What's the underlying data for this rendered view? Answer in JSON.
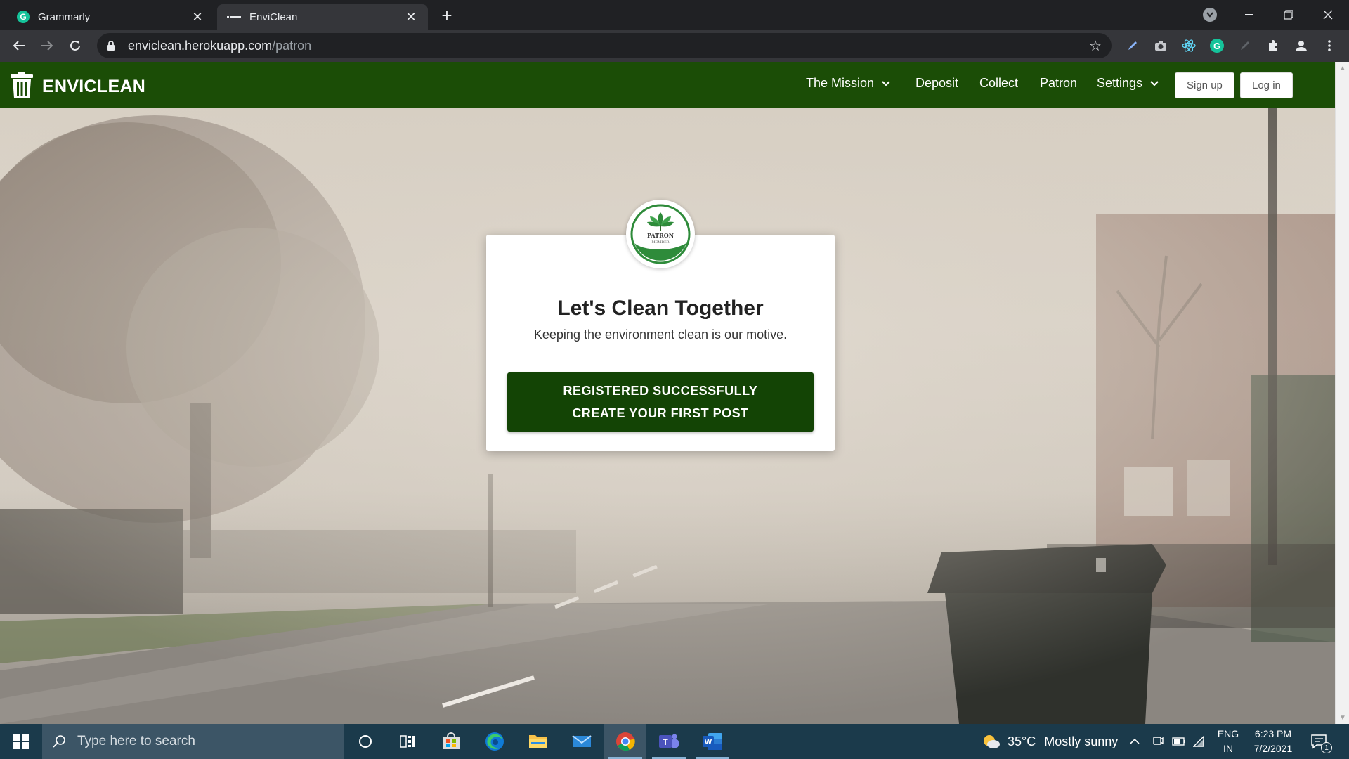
{
  "browser": {
    "tabs": [
      {
        "title": "Grammarly",
        "favicon": "grammarly-icon",
        "active": false
      },
      {
        "title": "EnviClean",
        "favicon": "dash-icon",
        "active": true
      }
    ],
    "url_host": "enviclean.herokuapp.com",
    "url_path": "/patron"
  },
  "site": {
    "brand": "ENVICLEAN",
    "brand_icon": "trash-can-icon",
    "colors": {
      "navbar": "#1b4d06",
      "button": "#134405"
    },
    "nav": {
      "mission": "The Mission",
      "deposit": "Deposit",
      "collect": "Collect",
      "patron": "Patron",
      "settings": "Settings",
      "signup": "Sign up",
      "login": "Log in"
    }
  },
  "card": {
    "badge_top": "PATRON",
    "badge_bottom": "MEMBER",
    "title": "Let's Clean Together",
    "subtitle": "Keeping the environment clean is our motive.",
    "cta_line1": "REGISTERED SUCCESSFULLY",
    "cta_line2": "CREATE YOUR FIRST POST"
  },
  "taskbar": {
    "search_placeholder": "Type here to search",
    "weather_temp": "35°C",
    "weather_desc": "Mostly sunny",
    "lang_line1": "ENG",
    "lang_line2": "IN",
    "time": "6:23 PM",
    "date": "7/2/2021",
    "notification_count": "1"
  }
}
